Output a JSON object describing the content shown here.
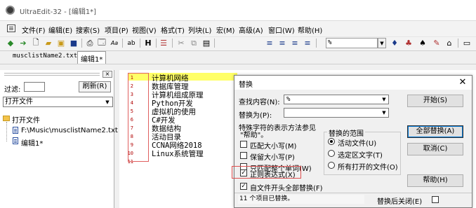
{
  "window": {
    "title": "UltraEdit-32 - [编辑1*]"
  },
  "menu": {
    "items": [
      "文件(F)",
      "编辑(E)",
      "搜索(S)",
      "项目(P)",
      "视图(V)",
      "格式(T)",
      "列块(L)",
      "宏(M)",
      "高级(A)",
      "窗口(W)",
      "帮助(H)"
    ]
  },
  "toolbar": {
    "search_value": "%",
    "icons": [
      "back-arrow-icon",
      "forward-arrow-icon",
      "new-file-icon",
      "open-folder-icon",
      "open-icon",
      "save-icon",
      "print-icon",
      "print-preview-icon",
      "font-icon",
      "replace-icon",
      "hex-icon",
      "paragraph-icon",
      "cut-icon",
      "copy-icon",
      "paste-icon",
      "align-left-icon",
      "align-center-icon",
      "align-right-icon",
      "justify-icon",
      "find-icon",
      "find-next-icon",
      "find-prev-icon",
      "spell-icon",
      "column-icon"
    ]
  },
  "tabs": {
    "items": [
      "musclistName2.txt",
      "编辑1*"
    ]
  },
  "left_panel": {
    "filter_label": "过滤:",
    "refresh_label": "刷新(R)",
    "select_value": "打开文件",
    "tree_root": "打开文件",
    "tree_items": [
      "F:\\Music\\musclistName2.txt",
      "编辑1*"
    ]
  },
  "editor": {
    "line_numbers": [
      "1",
      "2",
      "3",
      "4",
      "5",
      "6",
      "7",
      "8",
      "9",
      "10",
      "11"
    ],
    "lines": [
      "计算机网络",
      "数据库管理",
      "计算机组成原理",
      "Python开发",
      "虚拟机的使用",
      "C#开发",
      "数据结构",
      "活动目录",
      "CCNA网络2018",
      "Linux系统管理",
      ""
    ],
    "highlight_color": "#ffff66"
  },
  "dialog": {
    "title": "替换",
    "find_label": "查找内容(N):",
    "find_value": "%",
    "replace_label": "替换为(P):",
    "replace_value": "",
    "special_chars_label_1": "特殊字符的表示方法参见",
    "special_chars_label_2": "\"帮助\"。",
    "options": [
      {
        "label": "匹配大小写(M)",
        "checked": false
      },
      {
        "label": "保留大小写(P)",
        "checked": false
      },
      {
        "label": "只匹配整个单词(W)",
        "checked": false
      },
      {
        "label": "正则表达式(X)",
        "checked": true
      },
      {
        "label": "自文件开头全部替换(F)",
        "checked": true
      }
    ],
    "scope_title": "替换的范围",
    "scope_options": [
      {
        "label": "活动文件(U)",
        "selected": true
      },
      {
        "label": "选定区文字(T)",
        "selected": false
      },
      {
        "label": "所有打开的文件(O)",
        "selected": false
      }
    ],
    "buttons": {
      "start": "开始(S)",
      "replace_all": "全部替换(A)",
      "cancel": "取消(C)",
      "help": "帮助(H)"
    },
    "status": "11 个项目已替换。",
    "close_after_label": "替换后关闭(E)",
    "close_after_checked": false
  }
}
